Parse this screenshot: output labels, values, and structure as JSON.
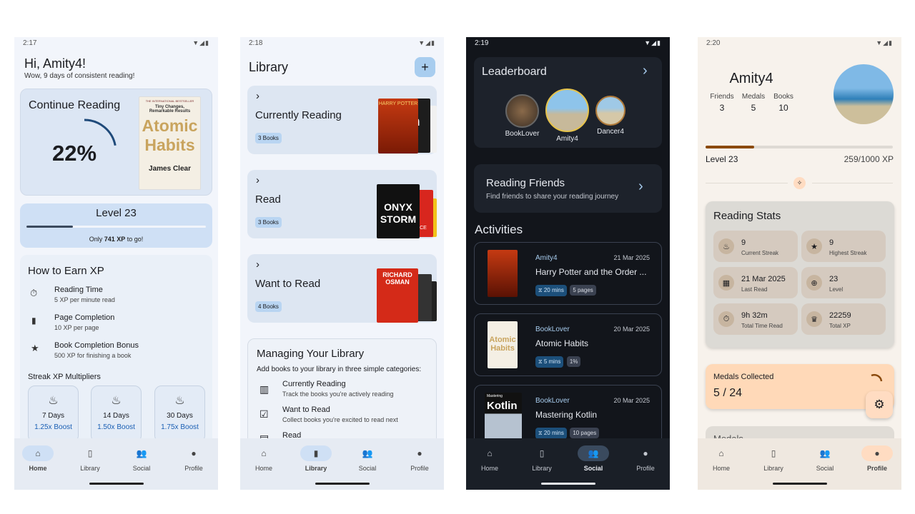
{
  "nav": {
    "home": "Home",
    "library": "Library",
    "social": "Social",
    "profile": "Profile"
  },
  "home": {
    "time": "2:17",
    "greeting": "Hi, Amity4!",
    "subtitle": "Wow, 9 days of consistent reading!",
    "continue_title": "Continue Reading",
    "progress_text": "22%",
    "progress_value": 0.22,
    "cover_top": "THE INTERNATIONAL BESTSELLER",
    "cover_tag": "Tiny Changes, Remarkable Results",
    "cover_title1": "Atomic",
    "cover_title2": "Habits",
    "cover_author": "James Clear",
    "level_title": "Level 23",
    "level_fraction": 0.259,
    "level_pre": "Only ",
    "level_xp": "741 XP",
    "level_post": " to go!",
    "earn_title": "How to Earn XP",
    "earn_items": [
      {
        "title": "Reading Time",
        "desc": "5 XP per minute read"
      },
      {
        "title": "Page Completion",
        "desc": "10 XP per page"
      },
      {
        "title": "Book Completion Bonus",
        "desc": "500 XP for finishing a book"
      }
    ],
    "streak_title": "Streak XP Multipliers",
    "multipliers": [
      {
        "days": "7 Days",
        "boost": "1.25x Boost"
      },
      {
        "days": "14 Days",
        "boost": "1.50x Boost"
      },
      {
        "days": "30 Days",
        "boost": "1.75x Boost"
      }
    ]
  },
  "library": {
    "time": "2:18",
    "title": "Library",
    "add_label": "+",
    "shelves": [
      {
        "name": "Currently Reading",
        "count": "3 Books"
      },
      {
        "name": "Read",
        "count": "3 Books"
      },
      {
        "name": "Want to Read",
        "count": "4 Books"
      }
    ],
    "shelf_covers": [
      [
        "HARRY POTTER",
        "in"
      ],
      [
        "ONYX STORM",
        "ICE"
      ],
      [
        "RICHARD OSMAN",
        "Thursday MURDER"
      ]
    ],
    "manage_title": "Managing Your Library",
    "manage_desc": "Add books to your library in three simple categories:",
    "manage_items": [
      {
        "title": "Currently Reading",
        "desc": "Track the books you're actively reading"
      },
      {
        "title": "Want to Read",
        "desc": "Collect books you're excited to read next"
      },
      {
        "title": "Read",
        "desc": ""
      }
    ]
  },
  "social": {
    "time": "2:19",
    "leaderboard_title": "Leaderboard",
    "leaders": [
      {
        "name": "BookLover"
      },
      {
        "name": "Amity4"
      },
      {
        "name": "Dancer4"
      }
    ],
    "friends_title": "Reading Friends",
    "friends_desc": "Find friends to share your reading journey",
    "activities_title": "Activities",
    "activities": [
      {
        "user": "Amity4",
        "date": "21 Mar 2025",
        "book": "Harry Potter and the Order ...",
        "mins": "20 mins",
        "pages": "5 pages"
      },
      {
        "user": "BookLover",
        "date": "20 Mar 2025",
        "book": "Atomic Habits",
        "mins": "5 mins",
        "pages": "1%"
      },
      {
        "user": "BookLover",
        "date": "20 Mar 2025",
        "book": "Mastering Kotlin",
        "mins": "20 mins",
        "pages": "10 pages"
      }
    ],
    "kotlin_cover": "Kotlin",
    "kotlin_top": "Mastering"
  },
  "profile": {
    "time": "2:20",
    "name": "Amity4",
    "stats": [
      {
        "label": "Friends",
        "value": "3"
      },
      {
        "label": "Medals",
        "value": "5"
      },
      {
        "label": "Books",
        "value": "10"
      }
    ],
    "level": "Level 23",
    "xp": "259/1000 XP",
    "xp_fraction": 0.259,
    "stats_title": "Reading Stats",
    "tiles": [
      {
        "value": "9",
        "label": "Current Streak"
      },
      {
        "value": "9",
        "label": "Highest Streak"
      },
      {
        "value": "21 Mar 2025",
        "label": "Last Read"
      },
      {
        "value": "23",
        "label": "Level"
      },
      {
        "value": "9h 32m",
        "label": "Total Time Read"
      },
      {
        "value": "22259",
        "label": "Total XP"
      }
    ],
    "medals_title": "Medals Collected",
    "medals_value": "5 / 24",
    "medals_peek": "Medals"
  },
  "colors": {
    "accent": "#1a5fb4",
    "level_bar": "#8b4a0c",
    "medals_bg": "#ffd9b8",
    "peach": "#ffdcc2"
  }
}
